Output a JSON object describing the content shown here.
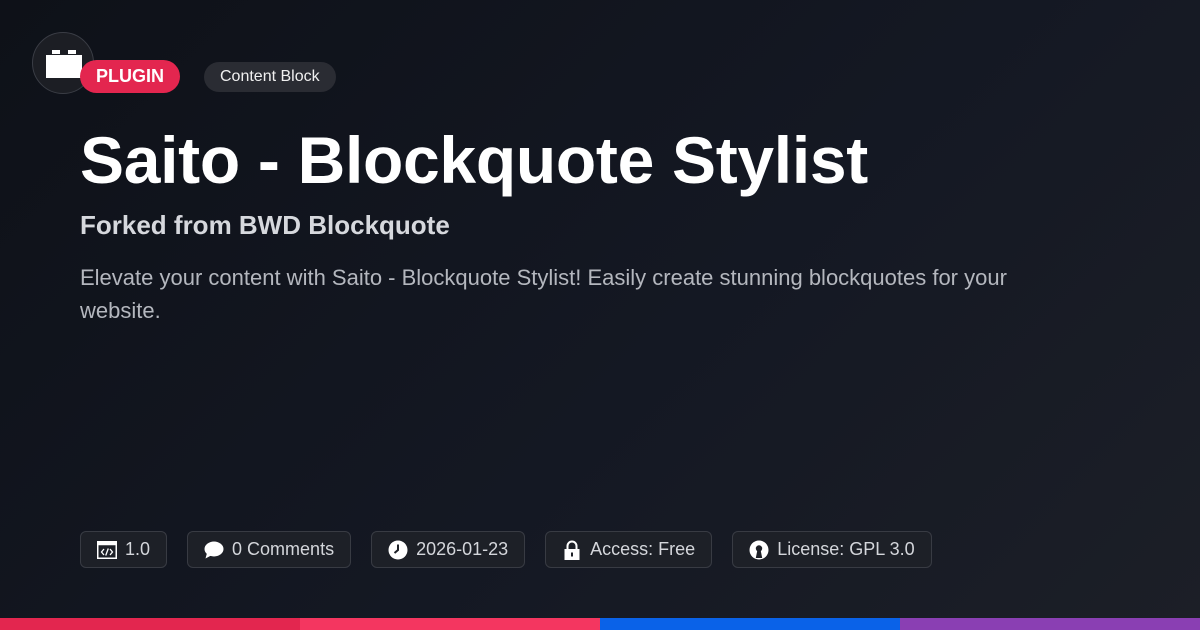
{
  "badges": {
    "type": "PLUGIN",
    "category": "Content Block"
  },
  "title": "Saito - Blockquote Stylist",
  "subtitle": "Forked from BWD Blockquote",
  "description": "Elevate your content with Saito - Blockquote Stylist! Easily create stunning blockquotes for your website.",
  "meta": {
    "version": "1.0",
    "comments": "0 Comments",
    "date": "2026-01-23",
    "access": "Access: Free",
    "license": "License: GPL 3.0"
  },
  "colors": {
    "accent": "#e3264f",
    "strip": [
      "#e3264f",
      "#f43660",
      "#0a62e8",
      "#8a3fb3"
    ]
  }
}
